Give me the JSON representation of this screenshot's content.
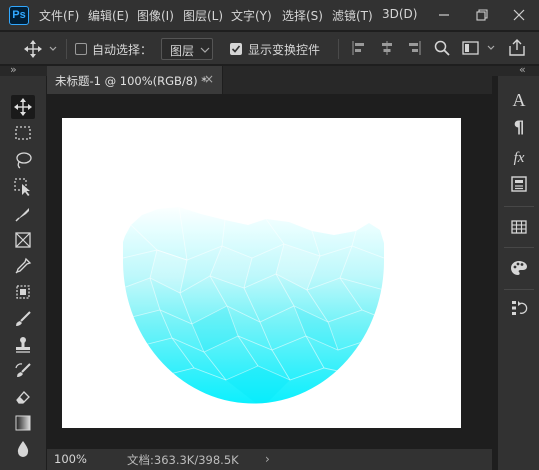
{
  "app": {
    "logo_text": "Ps"
  },
  "menu": {
    "items": [
      "文件(F)",
      "编辑(E)",
      "图像(I)",
      "图层(L)",
      "文字(Y)",
      "选择(S)",
      "滤镜(T)",
      "3D(D)"
    ]
  },
  "options": {
    "auto_select_label": "自动选择：",
    "auto_select_checked": false,
    "layer_dropdown_value": "图层",
    "show_transform_label": "显示变换控件",
    "show_transform_checked": true
  },
  "document": {
    "tab_title": "未标题-1 @ 100%(RGB/8) *",
    "close_glyph": "×"
  },
  "panel_toggles": {
    "left": "»",
    "right": "«"
  },
  "status": {
    "zoom": "100%",
    "doc_info": "文档:363.3K/398.5K",
    "arrow": "›"
  },
  "right_panel": {
    "character_glyph": "A",
    "paragraph_glyph": "¶",
    "fx_glyph": "fx"
  },
  "colors": {
    "accent": "#31a8ff",
    "panel_bg": "#323232",
    "shape_light": "#e8feff",
    "shape_dark": "#00f0ff"
  }
}
